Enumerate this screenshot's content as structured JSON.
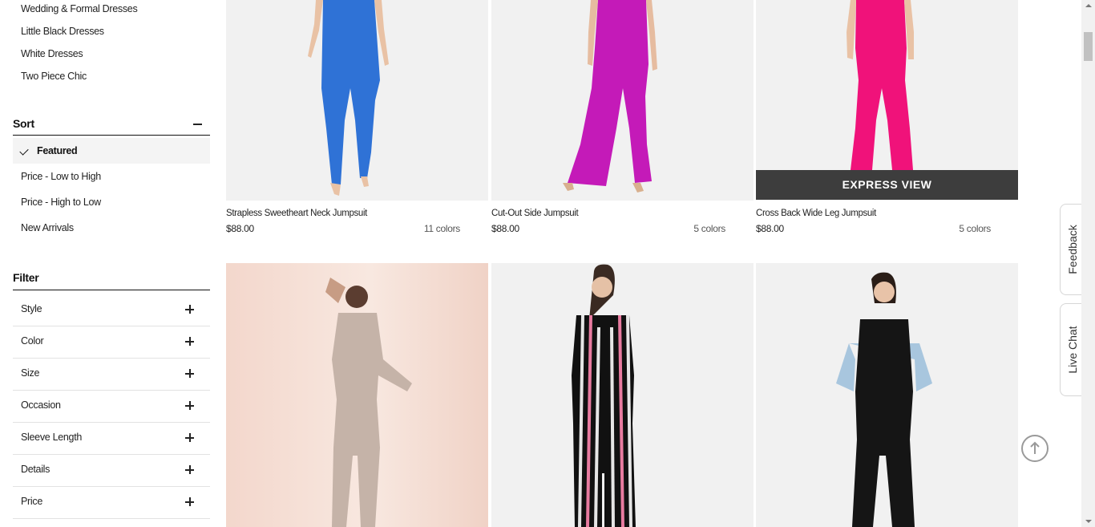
{
  "sidebar": {
    "categories": [
      "Wedding & Formal Dresses",
      "Little Black Dresses",
      "White Dresses",
      "Two Piece Chic"
    ],
    "sort": {
      "title": "Sort",
      "options": [
        "Featured",
        "Price - Low to High",
        "Price - High to Low",
        "New Arrivals"
      ],
      "selected": "Featured"
    },
    "filter": {
      "title": "Filter",
      "items": [
        "Style",
        "Color",
        "Size",
        "Occasion",
        "Sleeve Length",
        "Details",
        "Price"
      ]
    }
  },
  "products": [
    {
      "name": "Strapless Sweetheart Neck Jumpsuit",
      "price": "$88.00",
      "colors": "11 colors"
    },
    {
      "name": "Cut-Out Side Jumpsuit",
      "price": "$88.00",
      "colors": "5 colors"
    },
    {
      "name": "Cross Back Wide Leg Jumpsuit",
      "price": "$88.00",
      "colors": "5 colors"
    }
  ],
  "express_view_label": "EXPRESS VIEW",
  "side_tabs": {
    "feedback": "Feedback",
    "live_chat": "Live Chat"
  },
  "colors": {
    "blue": "#2f72d6",
    "magenta": "#c41ab8",
    "pink": "#f0127a"
  }
}
